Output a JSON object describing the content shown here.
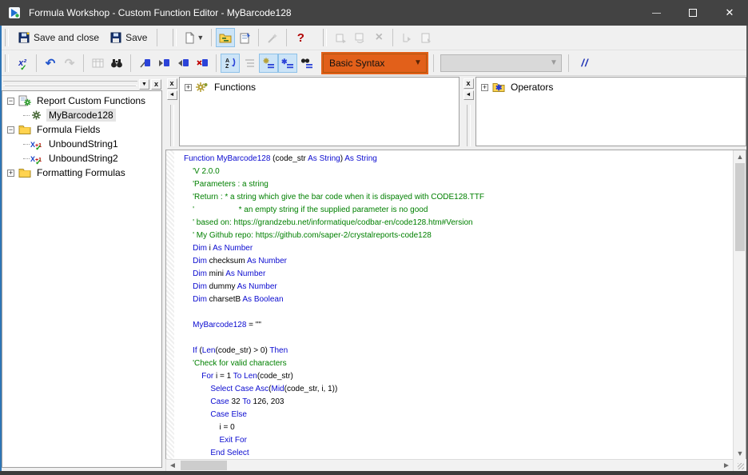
{
  "window": {
    "title": "Formula Workshop - Custom Function Editor - MyBarcode128",
    "controls": {
      "minimize": "minimize",
      "maximize": "maximize",
      "close": "close"
    }
  },
  "colors": {
    "titlebar": "#434343",
    "accent_orange": "#e2601a",
    "toggle_highlight": "#cce4f7",
    "keyword_blue": "#0b0bd0",
    "comment_green": "#008000"
  },
  "toolbar_main": {
    "save_and_close_label": "Save and close",
    "save_label": "Save",
    "icon_names": [
      "new-document",
      "workshop-tree-toggle",
      "properties",
      "use-expert-wand",
      "help",
      "add-to-repository",
      "add-from-repository",
      "delete",
      "expand-node",
      "show-formatting-formulas"
    ]
  },
  "toolbar_editor": {
    "glyphs": {
      "check": "x²",
      "check_mark": "✓",
      "undo": "↶",
      "redo": "↷",
      "comment": "//",
      "help": "?",
      "delete": "×"
    },
    "syntax_selector_value": "Basic Syntax",
    "zoom_selector_value": "",
    "icon_names": [
      "check-syntax",
      "undo",
      "redo",
      "browse-data",
      "find",
      "bookmark-toggle",
      "bookmark-next",
      "bookmark-previous",
      "bookmark-clear",
      "sort-trees",
      "field-tree",
      "function-tree",
      "operator-tree",
      "find-in-tree",
      "comment-uncomment"
    ]
  },
  "workshop_tree": {
    "items": [
      {
        "label": "Report Custom Functions",
        "level": 0,
        "expander": "-",
        "icon": "page-gear",
        "selected": false
      },
      {
        "label": "MyBarcode128",
        "level": 1,
        "expander": "",
        "icon": "gear",
        "selected": true
      },
      {
        "label": "Formula Fields",
        "level": 0,
        "expander": "-",
        "icon": "folder",
        "selected": false
      },
      {
        "label": "UnboundString1",
        "level": 1,
        "expander": "",
        "icon": "formula",
        "selected": false
      },
      {
        "label": "UnboundString2",
        "level": 1,
        "expander": "",
        "icon": "formula",
        "selected": false
      },
      {
        "label": "Formatting Formulas",
        "level": 0,
        "expander": "+",
        "icon": "folder",
        "selected": false
      }
    ]
  },
  "functions_panel": {
    "root_label": "Functions",
    "expander": "+",
    "icon": "gears"
  },
  "operators_panel": {
    "root_label": "Operators",
    "expander": "+",
    "icon": "op-folder"
  },
  "editor": {
    "lines": [
      [
        [
          "k",
          "Function MyBarcode128"
        ],
        [
          "p",
          " (code_str "
        ],
        [
          "k",
          "As"
        ],
        [
          "p",
          " "
        ],
        [
          "k",
          "String"
        ],
        [
          "p",
          ") "
        ],
        [
          "k",
          "As"
        ],
        [
          "p",
          " "
        ],
        [
          "k",
          "String"
        ]
      ],
      [
        [
          "c",
          "    'V 2.0.0"
        ]
      ],
      [
        [
          "c",
          "    'Parameters : a string"
        ]
      ],
      [
        [
          "c",
          "    'Return : * a string which give the bar code when it is dispayed with CODE128.TTF"
        ]
      ],
      [
        [
          "c",
          "    '                    * an empty string if the supplied parameter is no good"
        ]
      ],
      [
        [
          "c",
          "    ' based on: https://grandzebu.net/informatique/codbar-en/code128.htm#Version"
        ]
      ],
      [
        [
          "c",
          "    ' My Github repo: https://github.com/saper-2/crystalreports-code128"
        ]
      ],
      [
        [
          "p",
          "    "
        ],
        [
          "k",
          "Dim"
        ],
        [
          "p",
          " i "
        ],
        [
          "k",
          "As"
        ],
        [
          "p",
          " "
        ],
        [
          "k",
          "Number"
        ]
      ],
      [
        [
          "p",
          "    "
        ],
        [
          "k",
          "Dim"
        ],
        [
          "p",
          " checksum "
        ],
        [
          "k",
          "As"
        ],
        [
          "p",
          " "
        ],
        [
          "k",
          "Number"
        ]
      ],
      [
        [
          "p",
          "    "
        ],
        [
          "k",
          "Dim"
        ],
        [
          "p",
          " mini "
        ],
        [
          "k",
          "As"
        ],
        [
          "p",
          " "
        ],
        [
          "k",
          "Number"
        ]
      ],
      [
        [
          "p",
          "    "
        ],
        [
          "k",
          "Dim"
        ],
        [
          "p",
          " dummy "
        ],
        [
          "k",
          "As"
        ],
        [
          "p",
          " "
        ],
        [
          "k",
          "Number"
        ]
      ],
      [
        [
          "p",
          "    "
        ],
        [
          "k",
          "Dim"
        ],
        [
          "p",
          " charsetB "
        ],
        [
          "k",
          "As"
        ],
        [
          "p",
          " "
        ],
        [
          "k",
          "Boolean"
        ]
      ],
      [
        [
          "p",
          ""
        ]
      ],
      [
        [
          "p",
          "    "
        ],
        [
          "k",
          "MyBarcode128"
        ],
        [
          "p",
          " = \"\""
        ]
      ],
      [
        [
          "p",
          ""
        ]
      ],
      [
        [
          "p",
          "    "
        ],
        [
          "k",
          "If"
        ],
        [
          "p",
          " ("
        ],
        [
          "k",
          "Len"
        ],
        [
          "p",
          "(code_str) > 0) "
        ],
        [
          "k",
          "Then"
        ]
      ],
      [
        [
          "c",
          "    'Check for valid characters"
        ]
      ],
      [
        [
          "p",
          "        "
        ],
        [
          "k",
          "For"
        ],
        [
          "p",
          " i = 1 "
        ],
        [
          "k",
          "To"
        ],
        [
          "p",
          " "
        ],
        [
          "k",
          "Len"
        ],
        [
          "p",
          "(code_str)"
        ]
      ],
      [
        [
          "p",
          "            "
        ],
        [
          "k",
          "Select Case Asc"
        ],
        [
          "p",
          "("
        ],
        [
          "k",
          "Mid"
        ],
        [
          "p",
          "(code_str, i, 1))"
        ]
      ],
      [
        [
          "p",
          "            "
        ],
        [
          "k",
          "Case"
        ],
        [
          "p",
          " 32 "
        ],
        [
          "k",
          "To"
        ],
        [
          "p",
          " 126, 203"
        ]
      ],
      [
        [
          "p",
          "            "
        ],
        [
          "k",
          "Case Else"
        ]
      ],
      [
        [
          "p",
          "                i = 0"
        ]
      ],
      [
        [
          "p",
          "                "
        ],
        [
          "k",
          "Exit For"
        ]
      ],
      [
        [
          "p",
          "            "
        ],
        [
          "k",
          "End Select"
        ]
      ]
    ]
  }
}
